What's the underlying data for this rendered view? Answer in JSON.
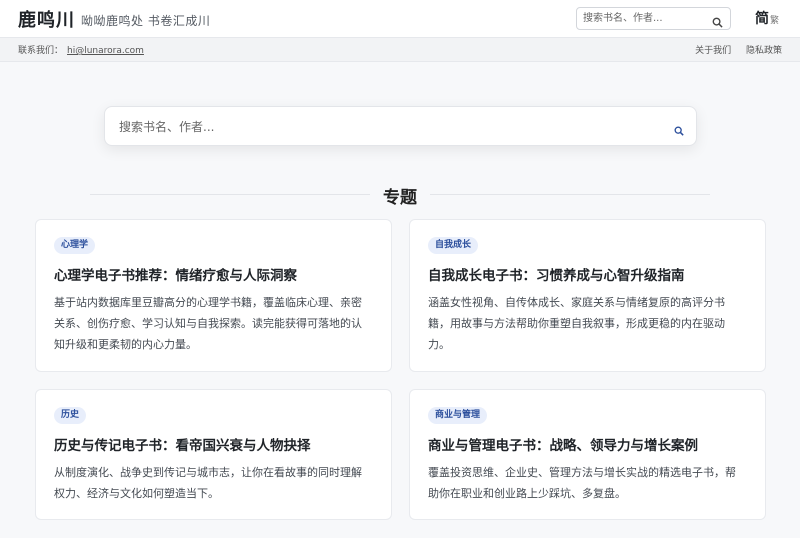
{
  "header": {
    "brand": "鹿鸣川",
    "tagline": "呦呦鹿鸣处 书卷汇成川",
    "search_placeholder": "搜索书名、作者...",
    "lang_simplified": "简",
    "lang_traditional": "繁"
  },
  "subbar": {
    "contact_label": "联系我们：",
    "contact_email": "hi@lunarora.com",
    "links": [
      "关于我们",
      "隐私政策"
    ]
  },
  "main_search": {
    "placeholder": "搜索书名、作者..."
  },
  "section": {
    "title": "专题"
  },
  "cards": [
    {
      "tag": "心理学",
      "title": "心理学电子书推荐：情绪疗愈与人际洞察",
      "desc": "基于站内数据库里豆瓣高分的心理学书籍，覆盖临床心理、亲密关系、创伤疗愈、学习认知与自我探索。读完能获得可落地的认知升级和更柔韧的内心力量。"
    },
    {
      "tag": "自我成长",
      "title": "自我成长电子书：习惯养成与心智升级指南",
      "desc": "涵盖女性视角、自传体成长、家庭关系与情绪复原的高评分书籍，用故事与方法帮助你重塑自我叙事，形成更稳的内在驱动力。"
    },
    {
      "tag": "历史",
      "title": "历史与传记电子书：看帝国兴衰与人物抉择",
      "desc": "从制度演化、战争史到传记与城市志，让你在看故事的同时理解权力、经济与文化如何塑造当下。"
    },
    {
      "tag": "商业与管理",
      "title": "商业与管理电子书：战略、领导力与增长案例",
      "desc": "覆盖投资思维、企业史、管理方法与增长实战的精选电子书，帮助你在职业和创业路上少踩坑、多复盘。"
    }
  ],
  "colors": {
    "accent": "#2c4f9c",
    "tag_bg": "#e8eefb"
  }
}
